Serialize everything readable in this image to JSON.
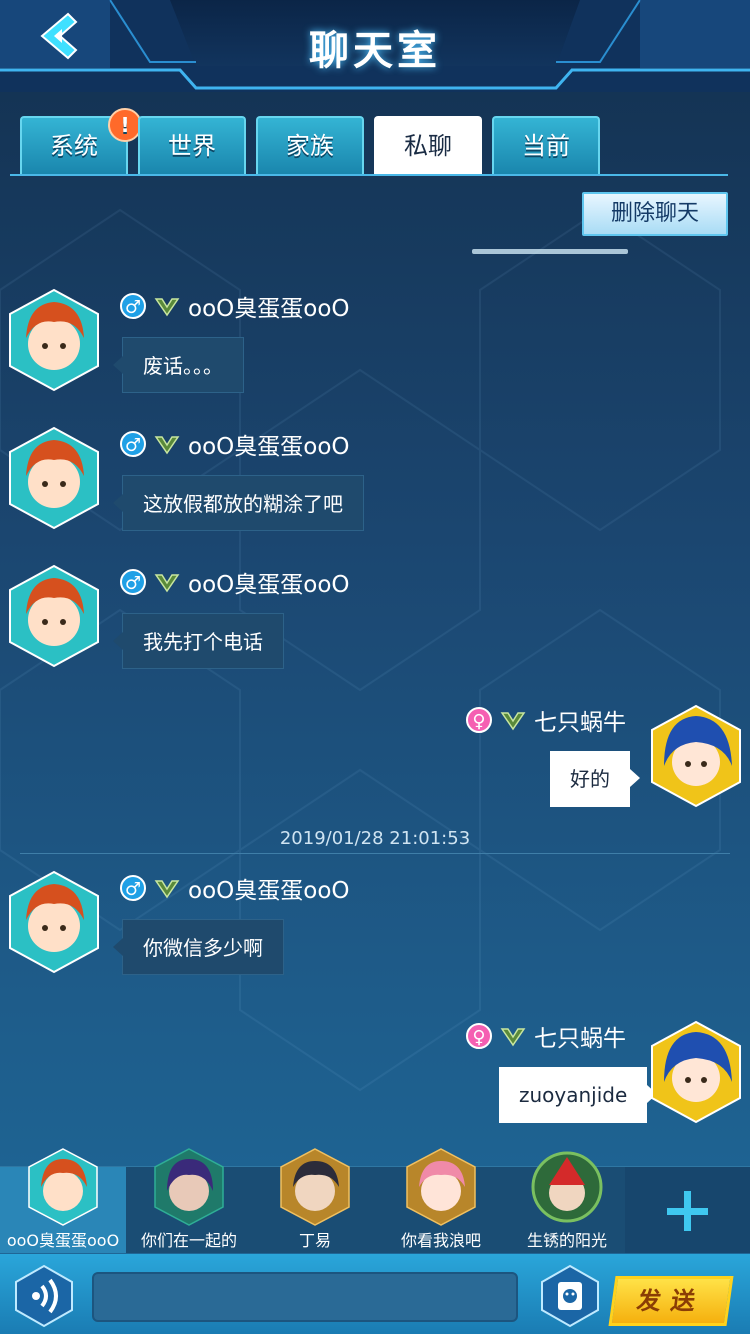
{
  "header": {
    "title": "聊天室"
  },
  "tabs": [
    {
      "label": "系统",
      "badge": "!"
    },
    {
      "label": "世界"
    },
    {
      "label": "家族"
    },
    {
      "label": "私聊",
      "active": true
    },
    {
      "label": "当前"
    }
  ],
  "toolbar": {
    "delete_label": "删除聊天"
  },
  "messages": [
    {
      "side": "left",
      "sender": "ooO臭蛋蛋ooO",
      "gender": "male",
      "text": "废话。。。"
    },
    {
      "side": "left",
      "sender": "ooO臭蛋蛋ooO",
      "gender": "male",
      "text": "这放假都放的糊涂了吧"
    },
    {
      "side": "left",
      "sender": "ooO臭蛋蛋ooO",
      "gender": "male",
      "text": "我先打个电话"
    },
    {
      "side": "right",
      "sender": "七只蜗牛",
      "gender": "female",
      "text": "好的"
    },
    {
      "side": "left",
      "sender": "ooO臭蛋蛋ooO",
      "gender": "male",
      "text": "你微信多少啊"
    },
    {
      "side": "right",
      "sender": "七只蜗牛",
      "gender": "female",
      "text": "zuoyanjide"
    }
  ],
  "timestamp": "2019/01/28  21:01:53",
  "gender_symbols": {
    "male": "♂",
    "female": "♀"
  },
  "contacts": [
    {
      "name": "ooO臭蛋蛋ooO",
      "active": true
    },
    {
      "name": "你们在一起的"
    },
    {
      "name": "丁易"
    },
    {
      "name": "你看我浪吧"
    },
    {
      "name": "生锈的阳光"
    }
  ],
  "input": {
    "placeholder": "",
    "send_label": "发送"
  },
  "colors": {
    "accent": "#2aa6da",
    "send": "#ffd21c",
    "male": "#1fa0e6",
    "female": "#f55fb2"
  },
  "icons": [
    "back-chevron-icon",
    "voice-icon",
    "emoji-icon",
    "add-icon",
    "rank-icon"
  ]
}
